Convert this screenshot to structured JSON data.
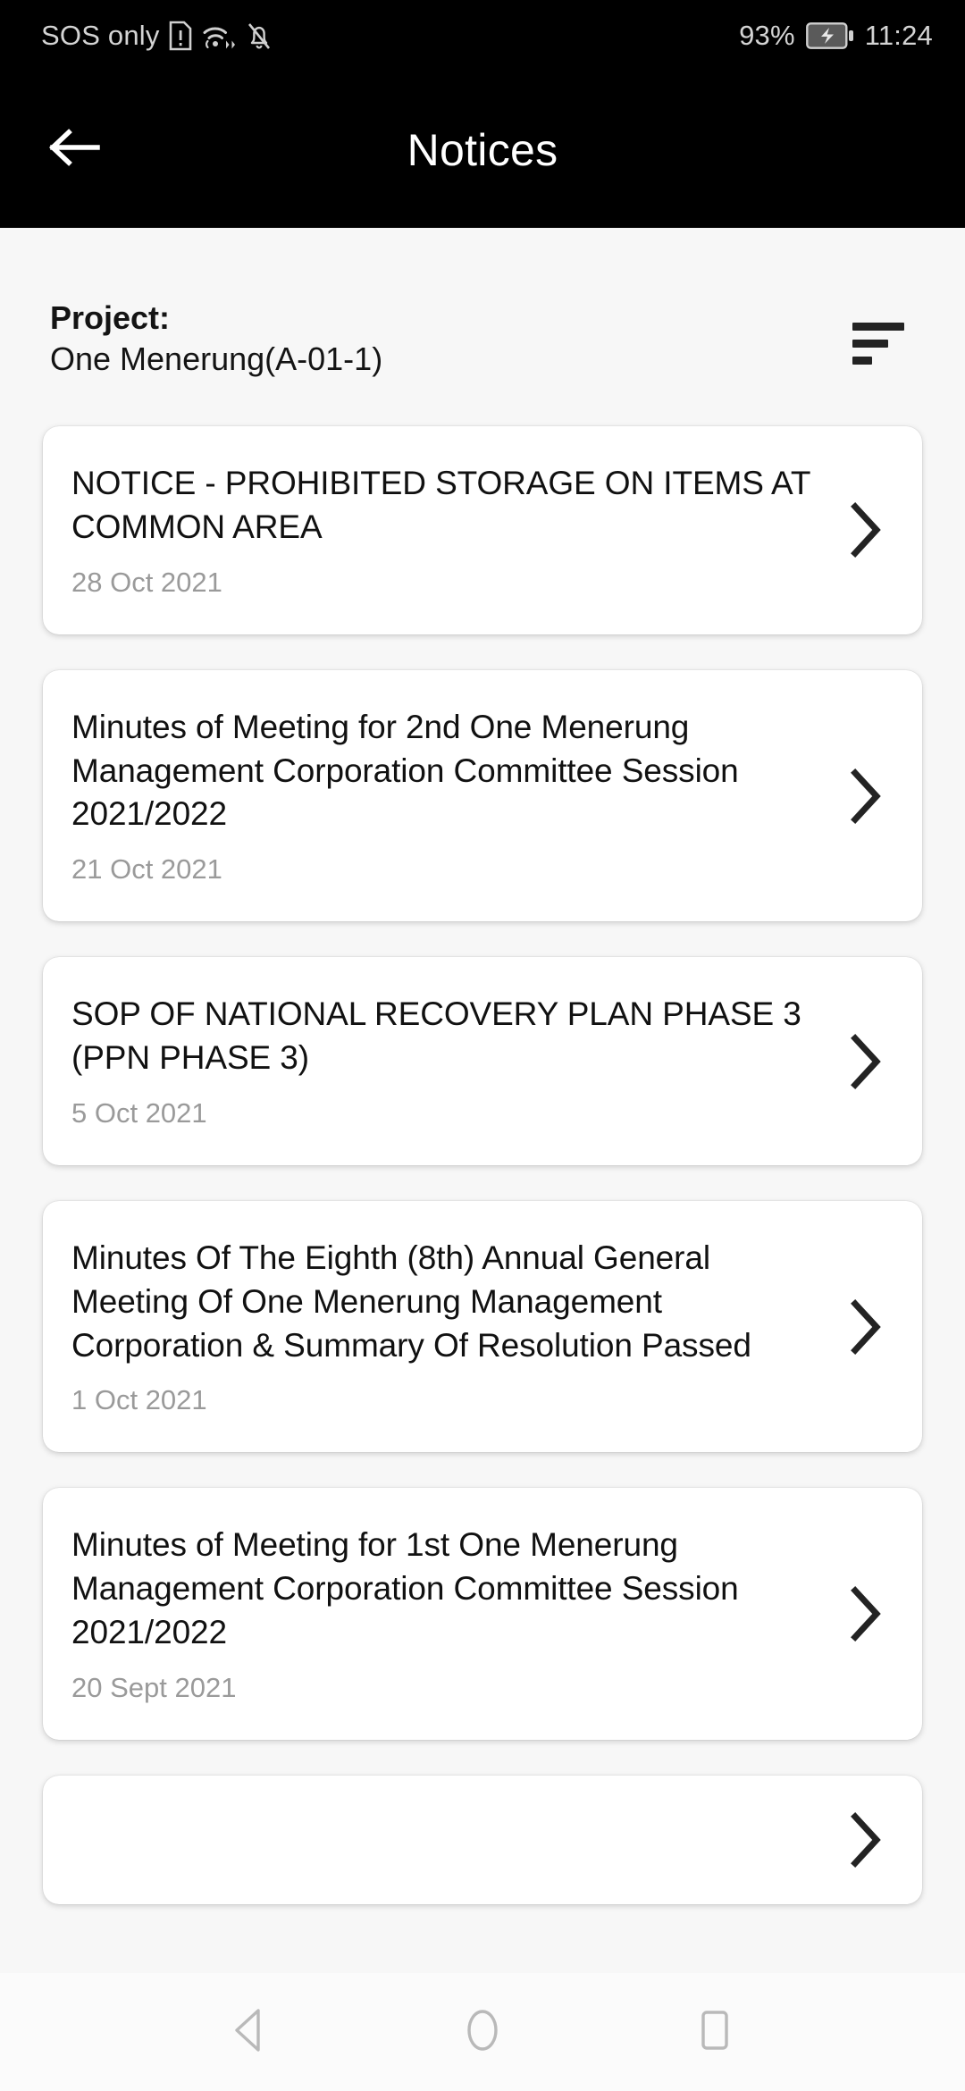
{
  "status_bar": {
    "carrier_text": "SOS only",
    "sim_icon": "sim-alert-icon",
    "wifi_icon": "wifi-hotspot-icon",
    "mute_icon": "bell-muted-icon",
    "battery_percent": "93%",
    "battery_icon": "battery-charging-icon",
    "time": "11:24"
  },
  "app_bar": {
    "back_icon": "arrow-left-icon",
    "title": "Notices"
  },
  "project": {
    "label": "Project:",
    "name": "One Menerung(A-01-1)",
    "sort_icon": "sort-icon"
  },
  "notices": [
    {
      "title": "NOTICE - PROHIBITED STORAGE ON ITEMS AT COMMON AREA",
      "date": "28 Oct 2021",
      "chevron_icon": "chevron-right-icon"
    },
    {
      "title": "Minutes of Meeting for 2nd One Menerung Management Corporation Committee Session 2021/2022",
      "date": "21 Oct 2021",
      "chevron_icon": "chevron-right-icon"
    },
    {
      "title": "SOP OF NATIONAL RECOVERY PLAN PHASE 3 (PPN PHASE 3)",
      "date": "5 Oct 2021",
      "chevron_icon": "chevron-right-icon"
    },
    {
      "title": "Minutes Of The Eighth (8th) Annual General Meeting Of One Menerung Management Corporation & Summary Of Resolution Passed",
      "date": "1 Oct 2021",
      "chevron_icon": "chevron-right-icon"
    },
    {
      "title": "Minutes of Meeting for 1st One Menerung Management Corporation Committee Session 2021/2022",
      "date": "20 Sept 2021",
      "chevron_icon": "chevron-right-icon"
    }
  ],
  "nav_bar": {
    "back_icon": "nav-back-triangle-icon",
    "home_icon": "nav-home-circle-icon",
    "recents_icon": "nav-recents-square-icon"
  },
  "colors": {
    "app_bar_bg": "#000000",
    "page_bg": "#f7f7f7",
    "card_bg": "#ffffff",
    "title_text": "#111111",
    "date_text": "#9a9a9a",
    "nav_bar_bg": "#fbfbfb"
  }
}
